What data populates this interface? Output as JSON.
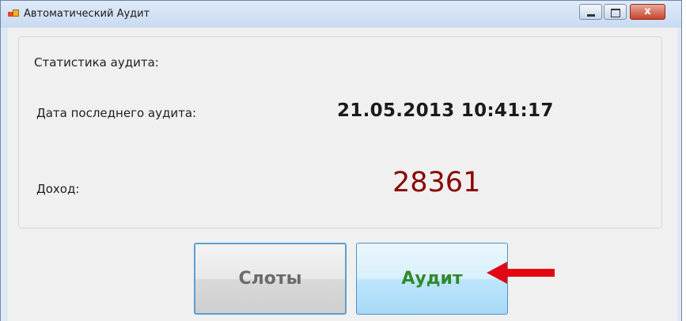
{
  "window": {
    "title": "Автоматический Аудит",
    "controls": [
      "minimize",
      "maximize",
      "close"
    ],
    "close_glyph": "x"
  },
  "stats": {
    "group_title": "Статистика аудита:",
    "last_audit_label": "Дата последнего аудита:",
    "last_audit_value": "21.05.2013 10:41:17",
    "income_label": "Доход:",
    "income_value": "28361"
  },
  "buttons": {
    "slots_label": "Слоты",
    "audit_label": "Аудит"
  },
  "colors": {
    "income_value": "#8a0000",
    "audit_text": "#2f8a2f",
    "annotation_arrow": "#e30613"
  },
  "icons": {
    "app": "app-icon",
    "annotation": "red-arrow-icon"
  }
}
